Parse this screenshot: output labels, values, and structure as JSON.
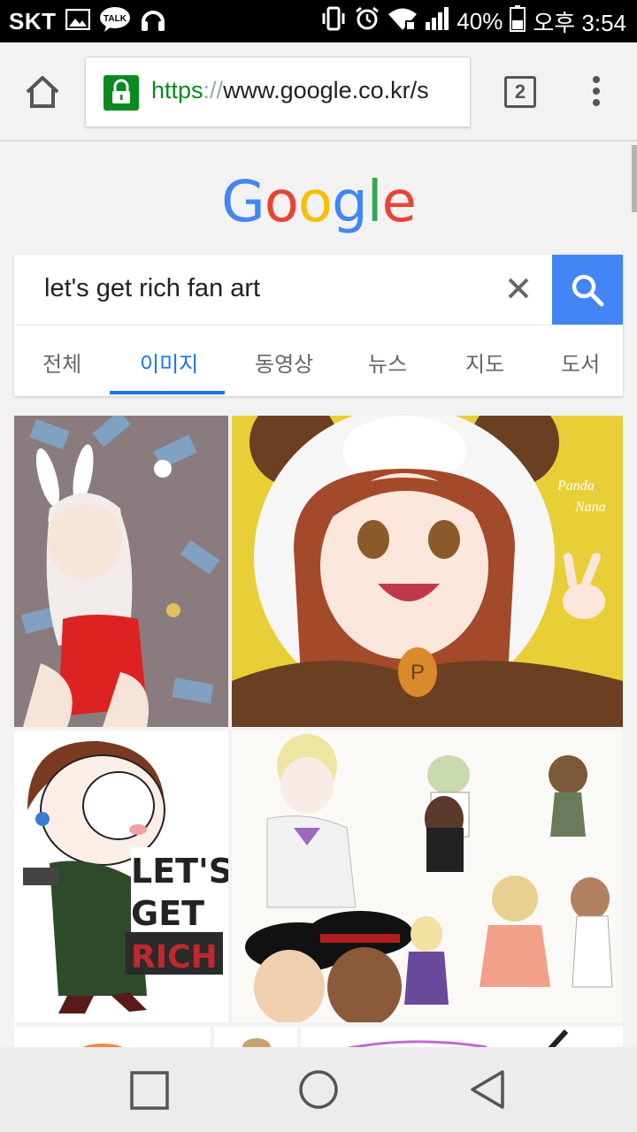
{
  "status_bar": {
    "carrier": "SKT",
    "talk_badge": "TALK",
    "battery": "40%",
    "time": "오후 3:54"
  },
  "browser": {
    "url_scheme": "https",
    "url_sep": "://",
    "url_host": "www.google.co.kr/s",
    "tab_count": "2"
  },
  "google": {
    "logo_letters": [
      {
        "char": "G",
        "color": "#4285f4"
      },
      {
        "char": "o",
        "color": "#ea4335"
      },
      {
        "char": "o",
        "color": "#fbbc05"
      },
      {
        "char": "g",
        "color": "#4285f4"
      },
      {
        "char": "l",
        "color": "#34a853"
      },
      {
        "char": "e",
        "color": "#ea4335"
      }
    ],
    "query": "let's get rich fan art",
    "tabs": [
      "전체",
      "이미지",
      "동영상",
      "뉴스",
      "지도",
      "도서"
    ],
    "active_tab": "이미지"
  },
  "image_results": {
    "thumb3_text": [
      "LET'S",
      "GET",
      "RICH"
    ],
    "thumb2_signature": [
      "Panda",
      "Nana"
    ]
  },
  "colors": {
    "accent": "#4285f4",
    "tab_active": "#1a73e8",
    "secure": "#0b8a1f"
  }
}
